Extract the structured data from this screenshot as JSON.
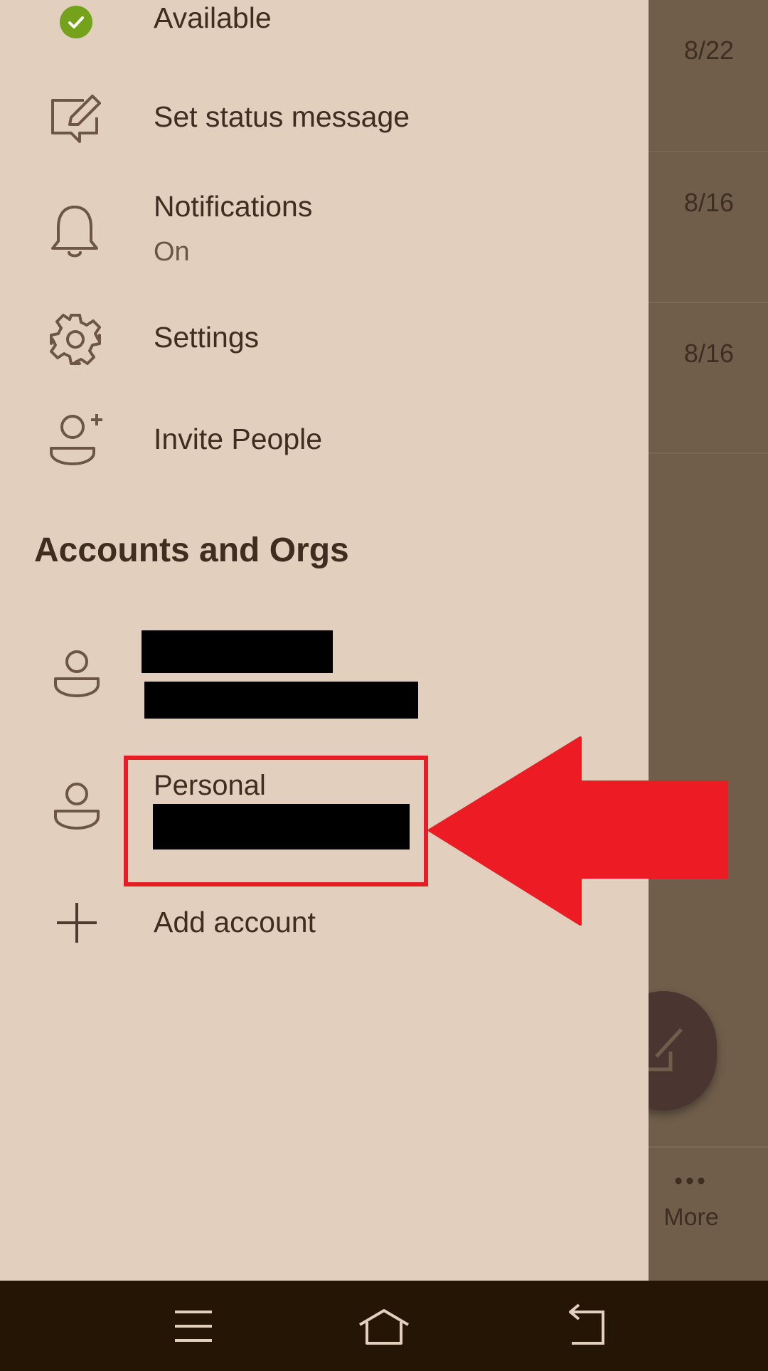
{
  "status": {
    "label": "Available",
    "color": "#74a31b"
  },
  "menu": [
    {
      "id": "set-status",
      "label": "Set status message",
      "icon": "status-message-icon"
    },
    {
      "id": "notifications",
      "label": "Notifications",
      "sub": "On",
      "icon": "bell-icon"
    },
    {
      "id": "settings",
      "label": "Settings",
      "icon": "gear-icon"
    },
    {
      "id": "invite",
      "label": "Invite People",
      "icon": "add-person-icon"
    }
  ],
  "accounts_section": {
    "title": "Accounts and Orgs"
  },
  "accounts": [
    {
      "name": "",
      "email": "",
      "redacted": true,
      "icon": "person-icon"
    },
    {
      "name": "Personal",
      "email": "",
      "redacted": true,
      "icon": "person-icon",
      "highlighted": true
    }
  ],
  "add_account": {
    "label": "Add account",
    "icon": "plus-icon"
  },
  "background": {
    "dates": [
      "8/22",
      "8/16",
      "8/16"
    ],
    "more_label": "More"
  },
  "annotation": {
    "arrow_color": "#ed1c24",
    "box_color": "#e81c24"
  },
  "navbar": {
    "buttons": [
      "menu-icon",
      "home-icon",
      "back-icon"
    ]
  }
}
